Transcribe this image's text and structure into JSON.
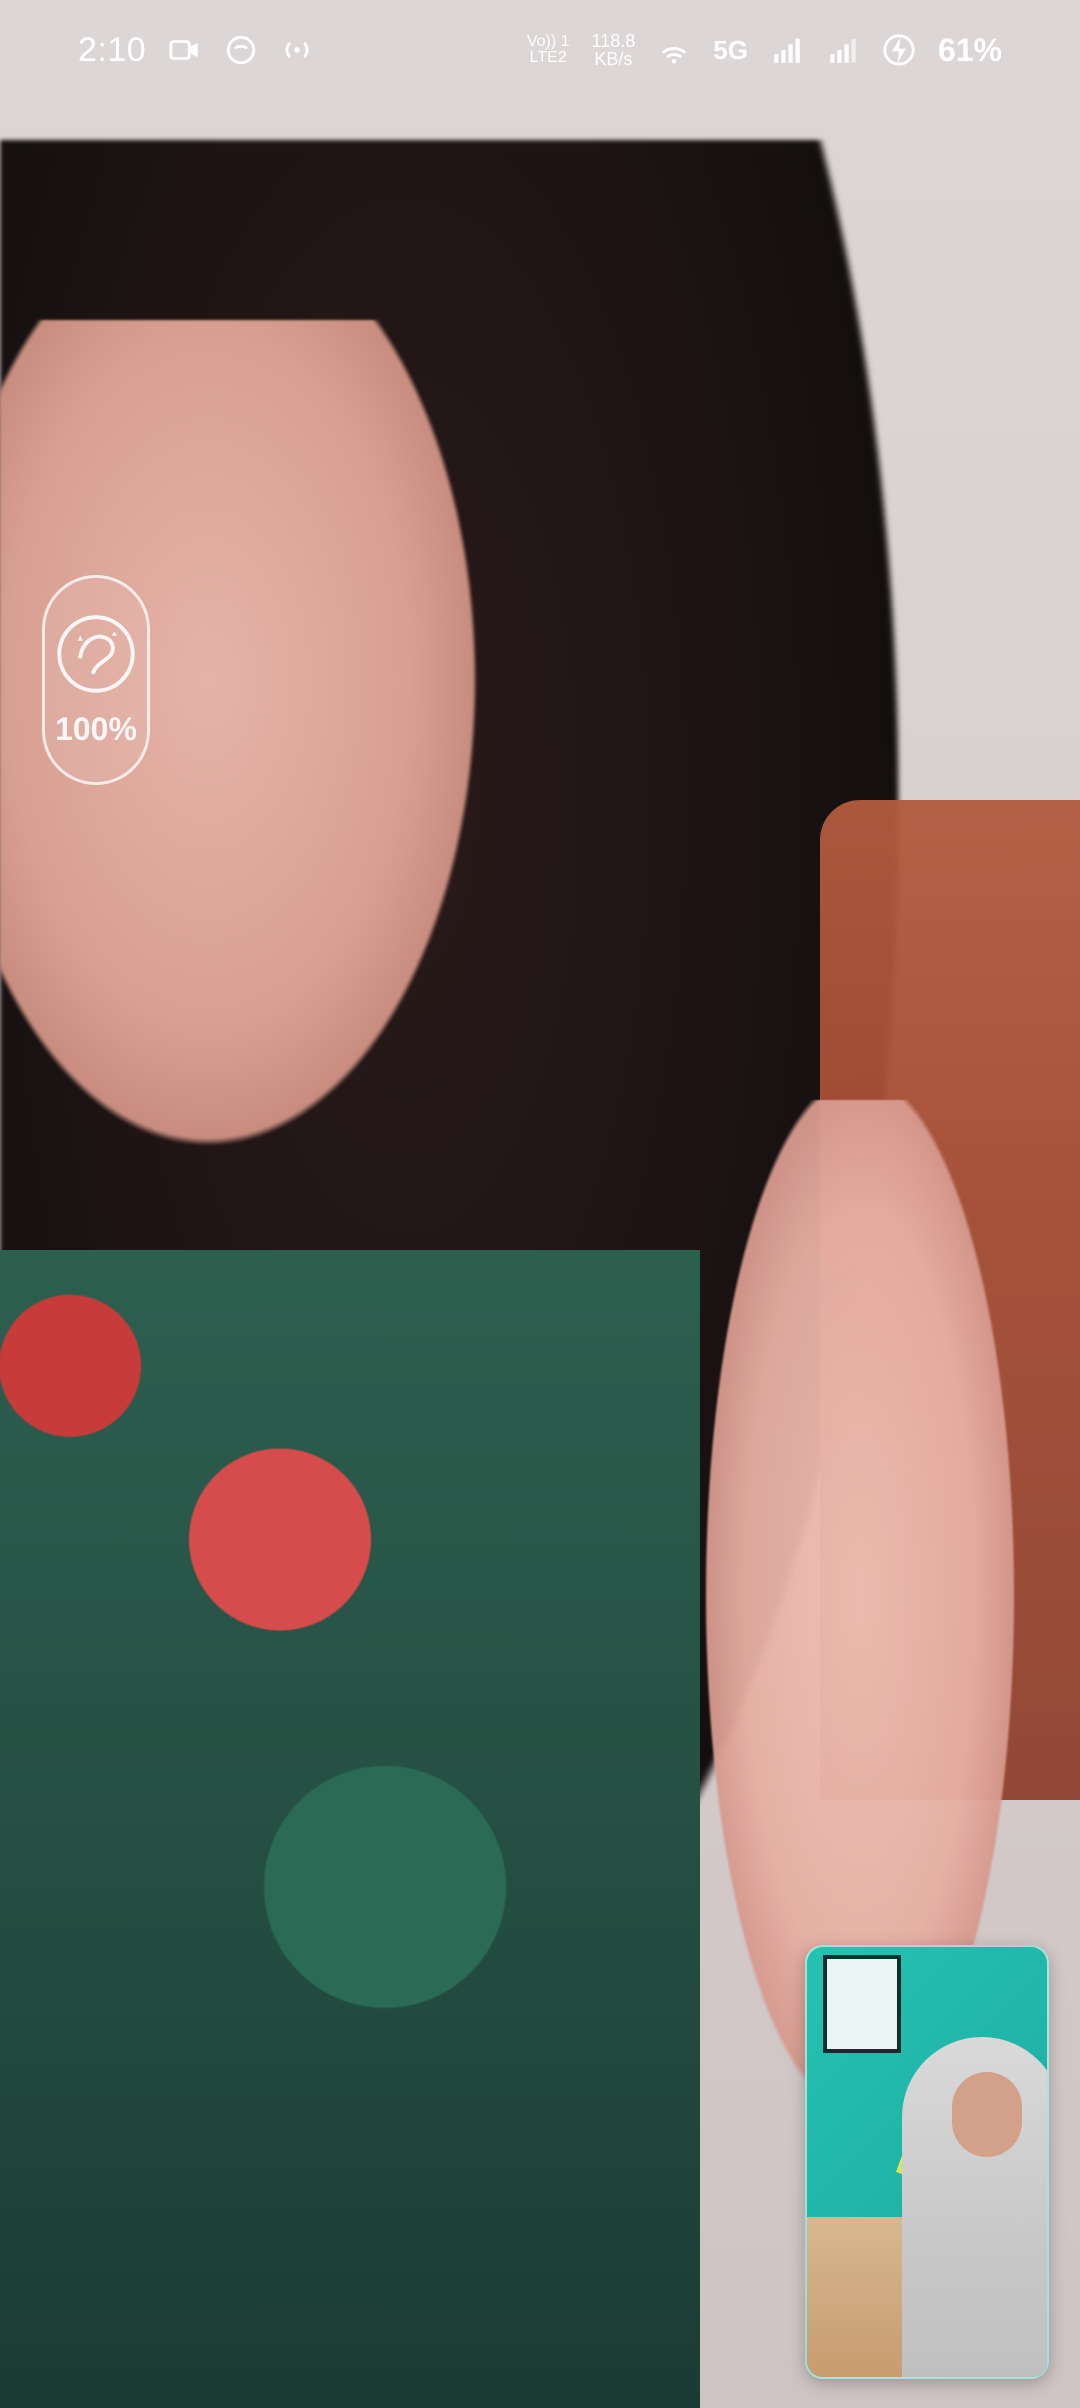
{
  "status_bar": {
    "time": "2:10",
    "volte_top": "Vo)) 1",
    "volte_bottom": "LTE2",
    "speed_value": "118.8",
    "speed_unit": "KB/s",
    "network": "5G",
    "battery": "61%",
    "icons": [
      "video-camera-icon",
      "hotspot-face-icon",
      "broadcast-icon",
      "wifi-icon",
      "signal-bars-icon",
      "charging-icon"
    ]
  },
  "beauty": {
    "percent": "100%",
    "icon": "beauty-face-icon"
  }
}
